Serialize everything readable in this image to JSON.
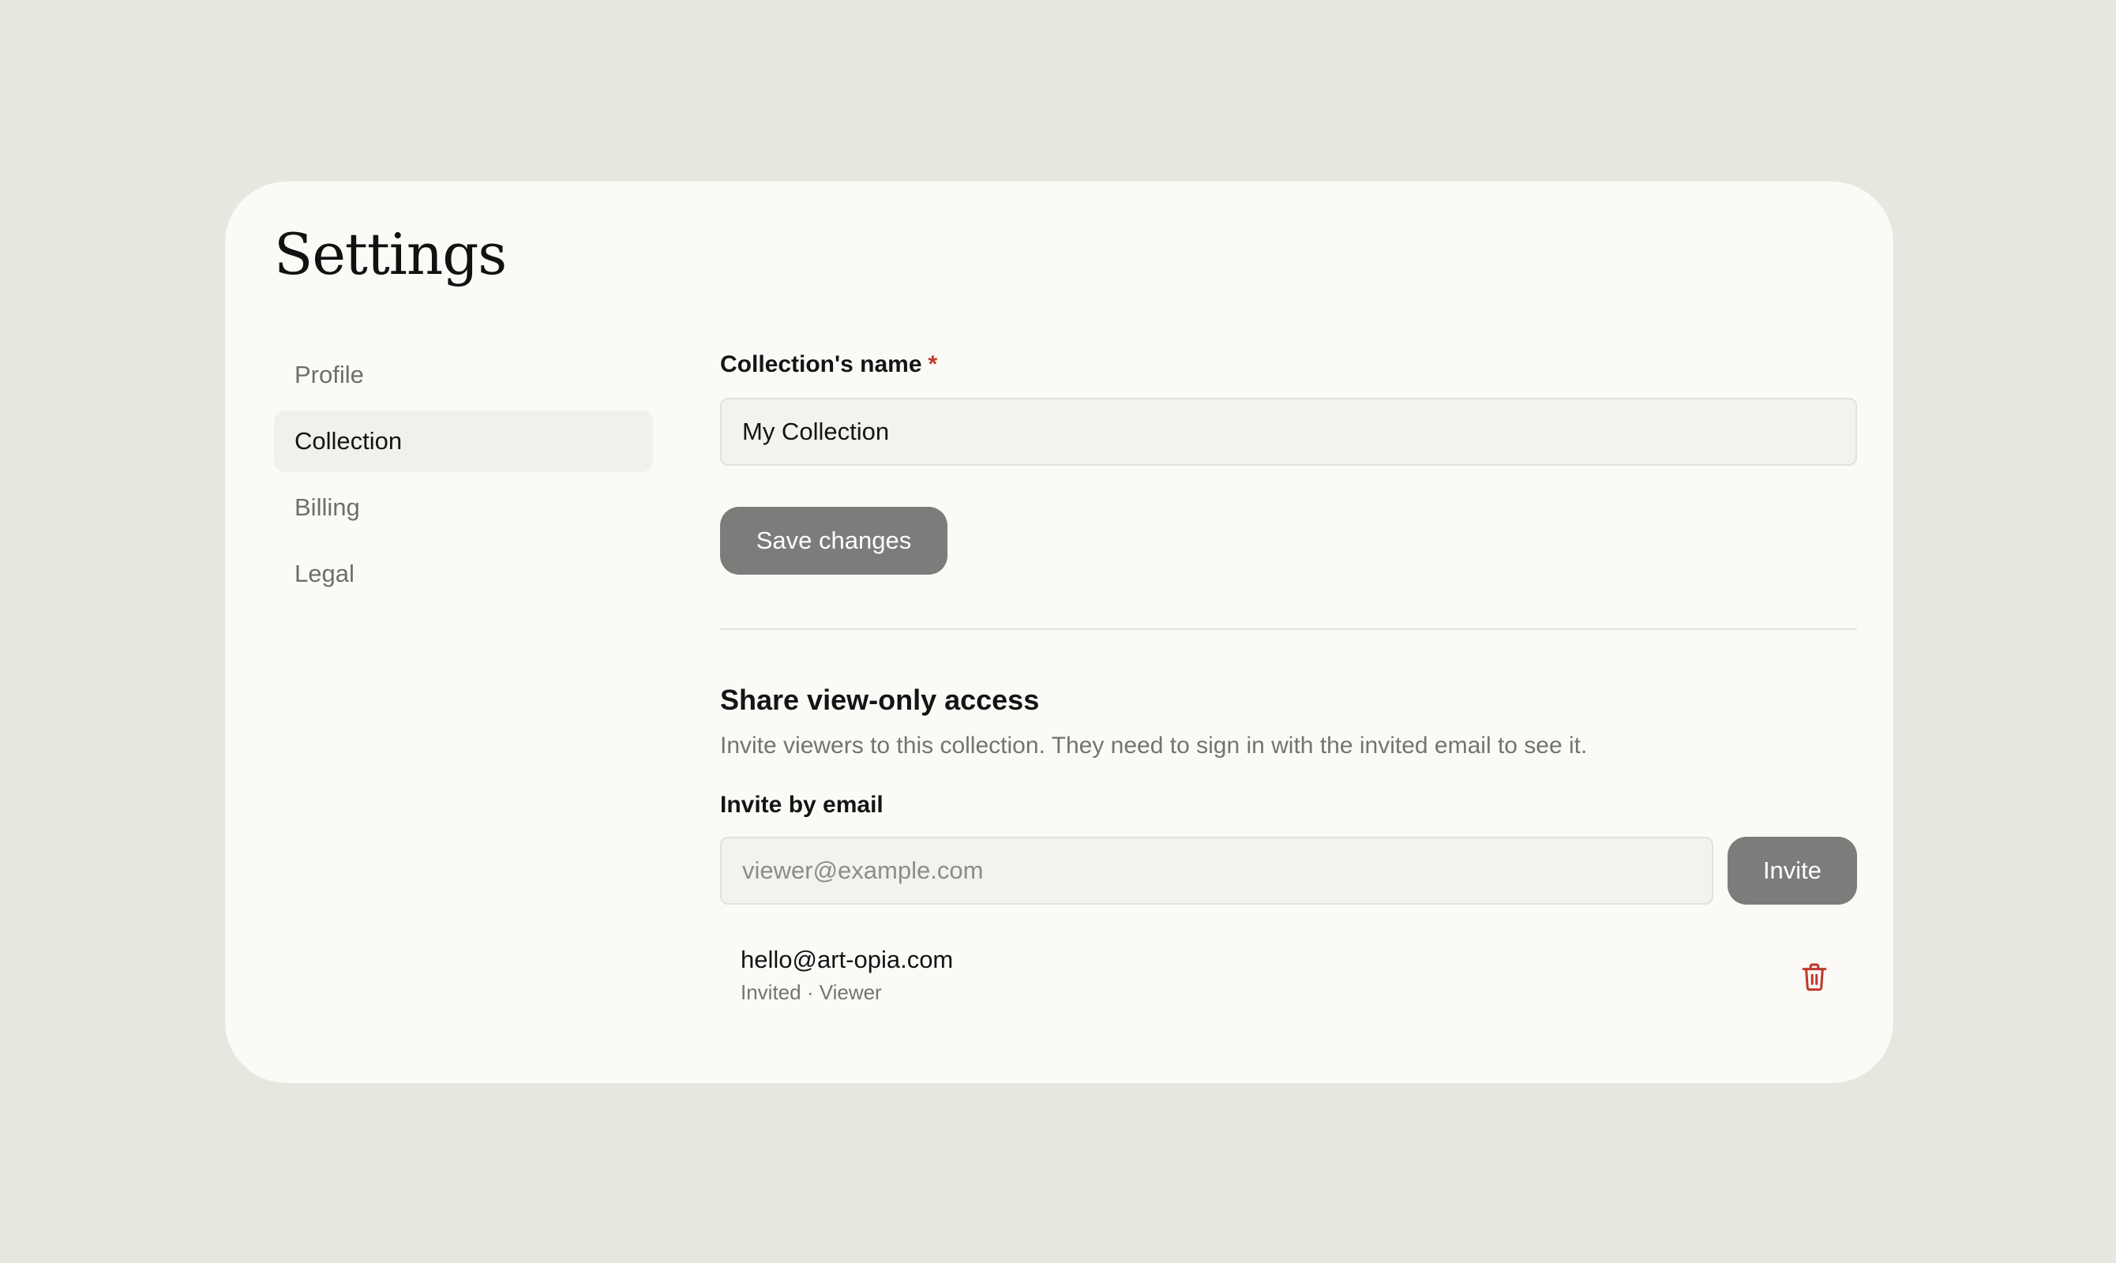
{
  "page": {
    "title": "Settings"
  },
  "sidebar": {
    "items": [
      {
        "label": "Profile",
        "active": false
      },
      {
        "label": "Collection",
        "active": true
      },
      {
        "label": "Billing",
        "active": false
      },
      {
        "label": "Legal",
        "active": false
      }
    ]
  },
  "collection": {
    "name_label": "Collection's name",
    "required_mark": "*",
    "name_value": "My Collection",
    "save_label": "Save changes"
  },
  "share": {
    "title": "Share view-only access",
    "description": "Invite viewers to this collection. They need to sign in with the invited email to see it.",
    "invite_label": "Invite by email",
    "invite_placeholder": "viewer@example.com",
    "invite_button": "Invite",
    "members": [
      {
        "email": "hello@art-opia.com",
        "status": "Invited · Viewer",
        "icon": "trash-icon"
      }
    ]
  },
  "colors": {
    "background": "#e8e7df",
    "card": "#fbfaf7",
    "button": "#7c7c7a",
    "danger": "#c0392b"
  }
}
